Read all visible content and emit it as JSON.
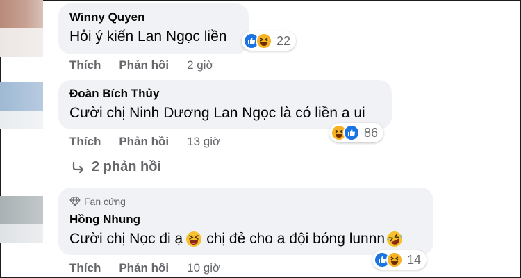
{
  "comments": [
    {
      "author": "Winny Quyen",
      "text": "Hỏi ý kiến Lan Ngọc liền",
      "reaction_count": "22",
      "like_label": "Thích",
      "reply_label": "Phản hồi",
      "time": "2 giờ"
    },
    {
      "author": "Đoàn Bích Thủy",
      "text": "Cười chị Ninh Dương Lan Ngọc là có liền a ui",
      "reaction_count": "86",
      "like_label": "Thích",
      "reply_label": "Phản hồi",
      "time": "13 giờ",
      "replies_link": "2 phản hồi"
    },
    {
      "badge": "Fan cứng",
      "author": "Hồng Nhung",
      "text_part1": "Cười chị Nọc đi ạ",
      "text_part2": "chị đẻ cho a đội bóng lunnn",
      "reaction_count": "14",
      "like_label": "Thích",
      "reply_label": "Phản hồi",
      "time": "10 giờ"
    }
  ],
  "icons": {
    "like": "like-icon",
    "haha": "haha-icon",
    "laugh_emoji": "grinning-squinting-emoji",
    "rofl_emoji": "rolling-laughing-emoji",
    "reply_arrow": "reply-arrow-icon",
    "fan_badge": "diamond-icon"
  },
  "colors": {
    "bubble": "#f0f2f5",
    "secondary_text": "#65676b",
    "like_blue": "#1b74e4",
    "haha_yellow": "#f7b125"
  }
}
